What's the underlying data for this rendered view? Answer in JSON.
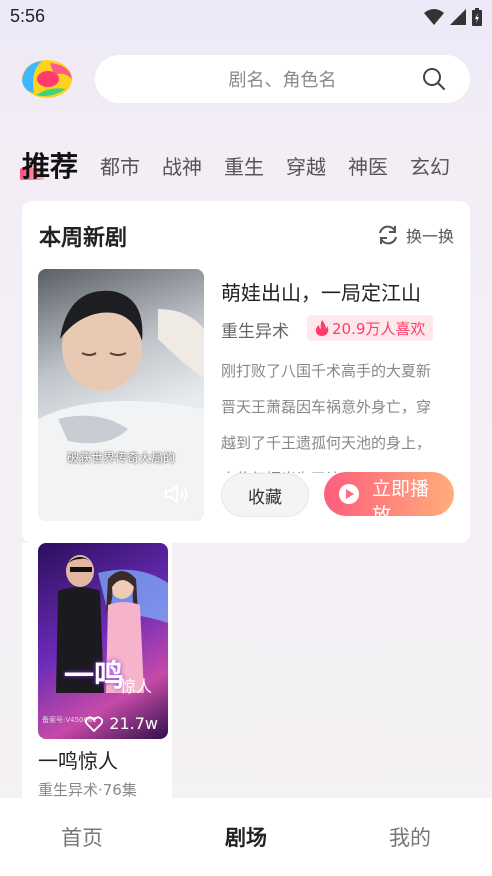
{
  "status_bar": {
    "time": "5:56"
  },
  "search": {
    "placeholder": "剧名、角色名"
  },
  "tabs": [
    {
      "label": "推荐",
      "active": true
    },
    {
      "label": "都市"
    },
    {
      "label": "战神"
    },
    {
      "label": "重生"
    },
    {
      "label": "穿越"
    },
    {
      "label": "神医"
    },
    {
      "label": "玄幻"
    }
  ],
  "weekly": {
    "title": "本周新剧",
    "refresh_label": "换一换",
    "drama": {
      "poster_caption": "破获世界传奇大局的",
      "title": "萌娃出山，一局定江山",
      "genre": "重生异术",
      "likes": "20.9万人喜欢",
      "description": "刚打败了八国千术高手的大夏新晋天王萧磊因车祸意外身亡，穿越到了千王遗孤何天池的身上，大伯何振光为了让",
      "collect_label": "收藏",
      "play_label": "立即播放"
    }
  },
  "grid": [
    {
      "poster_title": "一鸣",
      "poster_subtitle": "惊人",
      "poster_tiny": "备案号:V450061",
      "likes": "21.7w",
      "title": "一鸣惊人",
      "meta": "重生异术·76集"
    }
  ],
  "bottom_nav": [
    {
      "label": "首页"
    },
    {
      "label": "剧场",
      "active": true
    },
    {
      "label": "我的"
    }
  ],
  "colors": {
    "accent": "#ff3c6a",
    "play_gradient_start": "#ff5d7d",
    "play_gradient_end": "#ffae7a"
  }
}
